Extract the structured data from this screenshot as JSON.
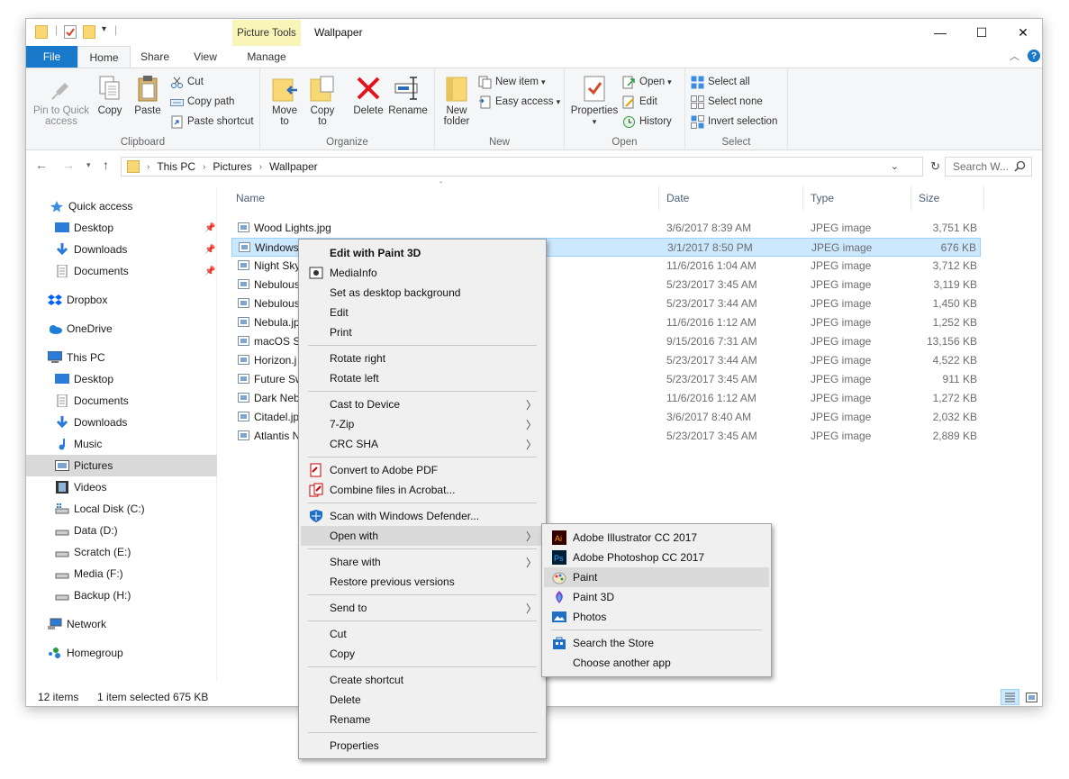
{
  "window": {
    "title": "Wallpaper",
    "contextual_tab": "Picture Tools",
    "controls": {
      "minimize": "—",
      "maximize": "☐",
      "close": "✕"
    }
  },
  "ribbon_tabs": [
    "File",
    "Home",
    "Share",
    "View",
    "Manage"
  ],
  "ribbon": {
    "clipboard": {
      "label": "Clipboard",
      "pin_to_quick_access": "Pin to Quick access",
      "copy": "Copy",
      "paste": "Paste",
      "cut": "Cut",
      "copy_path": "Copy path",
      "paste_shortcut": "Paste shortcut"
    },
    "organize": {
      "label": "Organize",
      "move_to": "Move to",
      "copy_to": "Copy to",
      "delete": "Delete",
      "rename": "Rename"
    },
    "new": {
      "label": "New",
      "new_folder": "New folder",
      "new_item": "New item",
      "easy_access": "Easy access"
    },
    "open": {
      "label": "Open",
      "properties": "Properties",
      "open": "Open",
      "edit": "Edit",
      "history": "History"
    },
    "select": {
      "label": "Select",
      "select_all": "Select all",
      "select_none": "Select none",
      "invert_selection": "Invert selection"
    }
  },
  "address": {
    "breadcrumbs": [
      "This PC",
      "Pictures",
      "Wallpaper"
    ],
    "search_placeholder": "Search W..."
  },
  "sidebar": {
    "items": [
      {
        "label": "Quick access",
        "icon": "star-icon"
      },
      {
        "label": "Desktop",
        "icon": "desktop-icon",
        "pinned": true
      },
      {
        "label": "Downloads",
        "icon": "downloads-icon",
        "pinned": true
      },
      {
        "label": "Documents",
        "icon": "documents-icon",
        "pinned": true
      },
      {
        "label": "Dropbox",
        "icon": "dropbox-icon"
      },
      {
        "label": "OneDrive",
        "icon": "onedrive-icon"
      },
      {
        "label": "This PC",
        "icon": "computer-icon"
      },
      {
        "label": "Desktop",
        "icon": "desktop-icon"
      },
      {
        "label": "Documents",
        "icon": "documents-icon"
      },
      {
        "label": "Downloads",
        "icon": "downloads-icon"
      },
      {
        "label": "Music",
        "icon": "music-icon"
      },
      {
        "label": "Pictures",
        "icon": "pictures-icon",
        "selected": true
      },
      {
        "label": "Videos",
        "icon": "videos-icon"
      },
      {
        "label": "Local Disk (C:)",
        "icon": "drive-icon"
      },
      {
        "label": "Data (D:)",
        "icon": "drive-icon"
      },
      {
        "label": "Scratch (E:)",
        "icon": "drive-icon"
      },
      {
        "label": "Media (F:)",
        "icon": "drive-icon"
      },
      {
        "label": "Backup (H:)",
        "icon": "drive-icon"
      },
      {
        "label": "Network",
        "icon": "network-icon"
      },
      {
        "label": "Homegroup",
        "icon": "homegroup-icon"
      }
    ]
  },
  "columns": [
    "Name",
    "Date",
    "Type",
    "Size"
  ],
  "files": [
    {
      "name": "Wood Lights.jpg",
      "date": "3/6/2017 8:39 AM",
      "type": "JPEG image",
      "size": "3,751 KB"
    },
    {
      "name": "Windows 10.jpg",
      "date": "3/1/2017 8:50 PM",
      "type": "JPEG image",
      "size": "676 KB",
      "selected": true
    },
    {
      "name": "Night Sky",
      "date": "11/6/2016 1:04 AM",
      "type": "JPEG image",
      "size": "3,712 KB"
    },
    {
      "name": "Nebulous",
      "date": "5/23/2017 3:45 AM",
      "type": "JPEG image",
      "size": "3,119 KB"
    },
    {
      "name": "Nebulous",
      "date": "5/23/2017 3:44 AM",
      "type": "JPEG image",
      "size": "1,450 KB"
    },
    {
      "name": "Nebula.jp",
      "date": "11/6/2016 1:12 AM",
      "type": "JPEG image",
      "size": "1,252 KB"
    },
    {
      "name": "macOS Si",
      "date": "9/15/2016 7:31 AM",
      "type": "JPEG image",
      "size": "13,156 KB"
    },
    {
      "name": "Horizon.j",
      "date": "5/23/2017 3:44 AM",
      "type": "JPEG image",
      "size": "4,522 KB"
    },
    {
      "name": "Future Sw",
      "date": "5/23/2017 3:45 AM",
      "type": "JPEG image",
      "size": "911 KB"
    },
    {
      "name": "Dark Neb",
      "date": "11/6/2016 1:12 AM",
      "type": "JPEG image",
      "size": "1,272 KB"
    },
    {
      "name": "Citadel.jp",
      "date": "3/6/2017 8:40 AM",
      "type": "JPEG image",
      "size": "2,032 KB"
    },
    {
      "name": "Atlantis N",
      "date": "5/23/2017 3:45 AM",
      "type": "JPEG image",
      "size": "2,889 KB"
    }
  ],
  "status": {
    "count": "12 items",
    "selection": "1 item selected  675 KB"
  },
  "context_menu": {
    "items": [
      {
        "label": "Edit with Paint 3D",
        "bold": true
      },
      {
        "label": "MediaInfo",
        "icon": "mediainfo-icon"
      },
      {
        "label": "Set as desktop background"
      },
      {
        "label": "Edit"
      },
      {
        "label": "Print"
      },
      {
        "label": "Rotate right"
      },
      {
        "label": "Rotate left"
      },
      {
        "label": "Cast to Device",
        "submenu": true
      },
      {
        "label": "7-Zip",
        "submenu": true
      },
      {
        "label": "CRC SHA",
        "submenu": true
      },
      {
        "label": "Convert to Adobe PDF",
        "icon": "adobe-pdf-icon"
      },
      {
        "label": "Combine files in Acrobat...",
        "icon": "acrobat-icon"
      },
      {
        "label": "Scan with Windows Defender...",
        "icon": "defender-icon"
      },
      {
        "label": "Open with",
        "submenu": true,
        "highlighted": true
      },
      {
        "label": "Share with",
        "submenu": true
      },
      {
        "label": "Restore previous versions"
      },
      {
        "label": "Send to",
        "submenu": true
      },
      {
        "label": "Cut"
      },
      {
        "label": "Copy"
      },
      {
        "label": "Create shortcut"
      },
      {
        "label": "Delete"
      },
      {
        "label": "Rename"
      },
      {
        "label": "Properties"
      }
    ]
  },
  "open_with_menu": {
    "items": [
      {
        "label": "Adobe Illustrator CC 2017",
        "icon": "illustrator-icon",
        "badge": "Ai"
      },
      {
        "label": "Adobe Photoshop CC 2017",
        "icon": "photoshop-icon",
        "badge": "Ps"
      },
      {
        "label": "Paint",
        "icon": "paint-icon",
        "highlighted": true
      },
      {
        "label": "Paint 3D",
        "icon": "paint3d-icon"
      },
      {
        "label": "Photos",
        "icon": "photos-icon"
      },
      {
        "label": "Search the Store",
        "icon": "store-icon"
      },
      {
        "label": "Choose another app"
      }
    ]
  },
  "colors": {
    "accent": "#1979ca",
    "selection": "#cce8ff",
    "picture_tools_tab": "#f9f5b9",
    "menu_bg": "#f0f0f0",
    "menu_highlight": "#dadada"
  }
}
